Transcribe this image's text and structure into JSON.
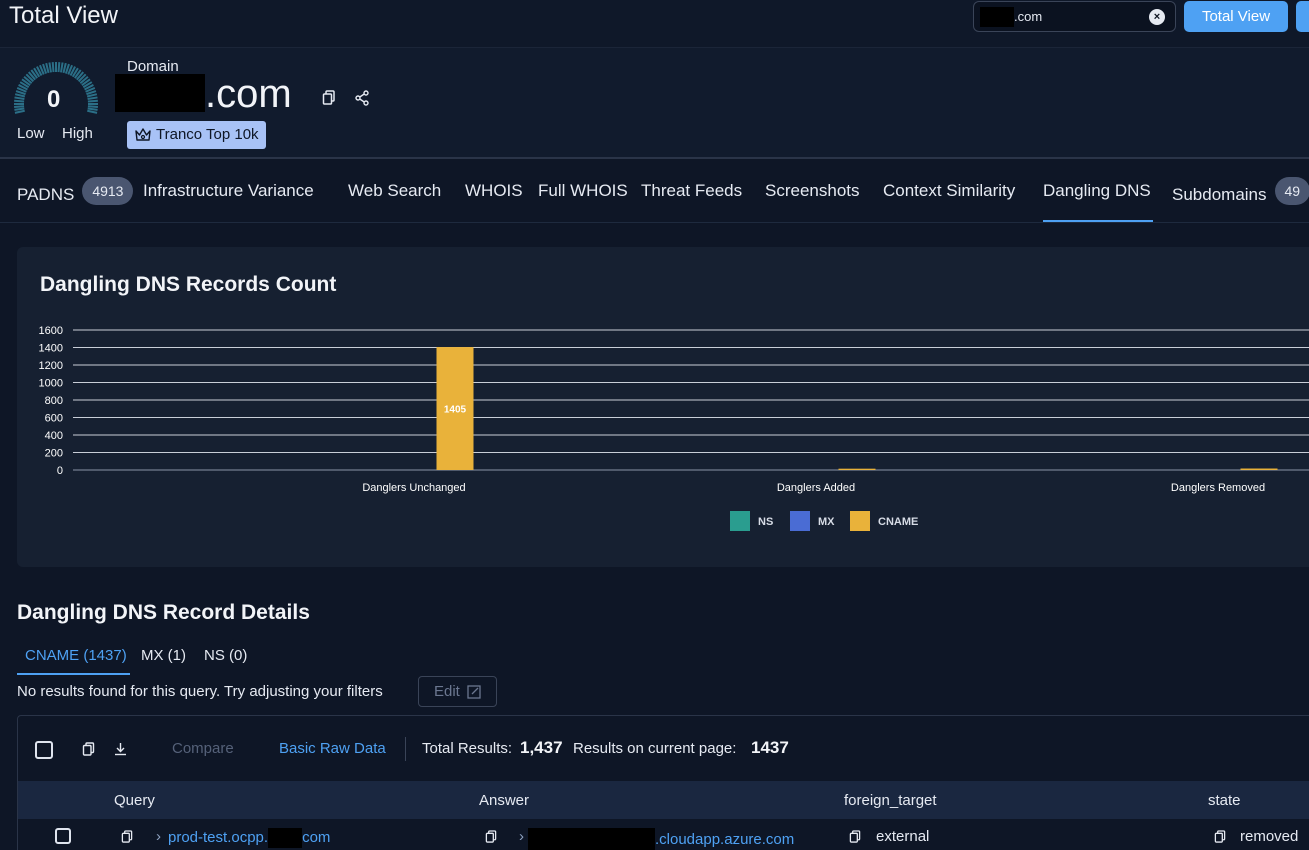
{
  "header": {
    "title": "Total View",
    "search_value": ".com",
    "total_view_button": "Total View"
  },
  "domain": {
    "score": "0",
    "low_label": "Low",
    "high_label": "High",
    "label": "Domain",
    "name_suffix": ".com",
    "badge": "Tranco Top 10k"
  },
  "tabs": [
    {
      "label": "PADNS",
      "count": "4913"
    },
    {
      "label": "Infrastructure Variance"
    },
    {
      "label": "Web Search"
    },
    {
      "label": "WHOIS"
    },
    {
      "label": "Full WHOIS"
    },
    {
      "label": "Threat Feeds"
    },
    {
      "label": "Screenshots"
    },
    {
      "label": "Context Similarity"
    },
    {
      "label": "Dangling DNS",
      "active": true
    },
    {
      "label": "Subdomains",
      "count": "49"
    }
  ],
  "chart_data": {
    "type": "bar",
    "title": "Dangling DNS Records Count",
    "categories": [
      "Danglers Unchanged",
      "Danglers Added",
      "Danglers Removed"
    ],
    "series": [
      {
        "name": "NS",
        "color": "#2a9d8f",
        "values": [
          0,
          0,
          0
        ]
      },
      {
        "name": "MX",
        "color": "#4a6cd4",
        "values": [
          0,
          0,
          0
        ]
      },
      {
        "name": "CNAME",
        "color": "#e9b23a",
        "values": [
          1405,
          15,
          17
        ]
      }
    ],
    "data_labels": [
      "1405",
      "",
      ""
    ],
    "yticks": [
      "0",
      "200",
      "400",
      "600",
      "800",
      "1000",
      "1200",
      "1400",
      "1600"
    ],
    "ylim": [
      0,
      1600
    ],
    "legend": "bottom-center",
    "grid": true
  },
  "details": {
    "title": "Dangling DNS Record Details",
    "subtabs": [
      "CNAME (1437)",
      "MX (1)",
      "NS (0)"
    ],
    "no_results": "No results found for this query. Try adjusting your filters",
    "edit_label": "Edit",
    "toolbar": {
      "compare": "Compare",
      "basic_raw": "Basic Raw Data",
      "total_label": "Total Results:",
      "total_value": "1,437",
      "page_label": "Results on current page:",
      "page_value": "1437"
    },
    "columns": [
      "Query",
      "Answer",
      "foreign_target",
      "state"
    ],
    "rows": [
      {
        "query_prefix": "prod-test.ocpp.",
        "query_suffix": "com",
        "answer_suffix": ".cloudapp.azure.com",
        "foreign_target": "external",
        "state": "removed"
      }
    ]
  }
}
